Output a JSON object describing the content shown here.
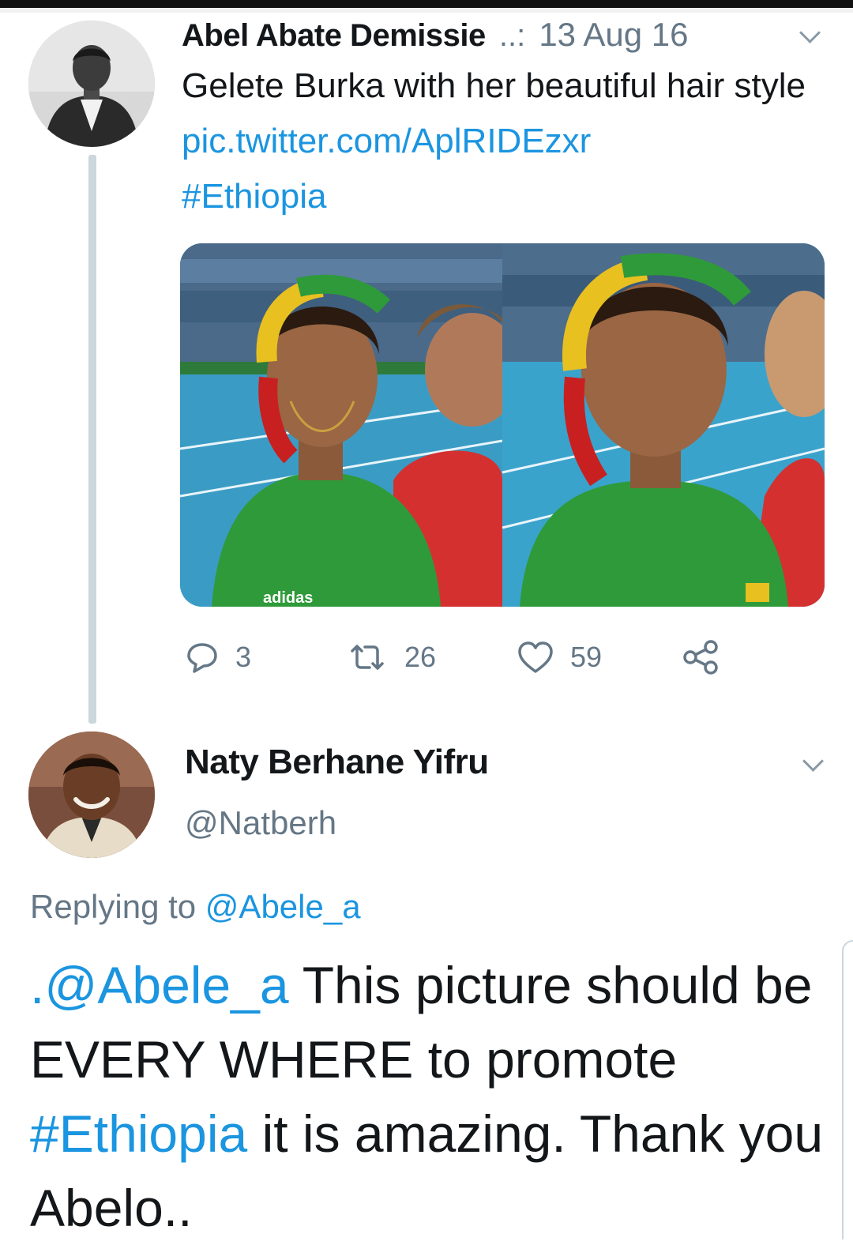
{
  "tweet1": {
    "author_name": "Abel Abate Demissie",
    "separator": "..:",
    "date": "13 Aug 16",
    "text_plain": "Gelete Burka with her beautiful hair style",
    "link": "pic.twitter.com/AplRIDEzxr",
    "hashtag": "#Ethiopia",
    "media_alt_brand": "adidas",
    "actions": {
      "replies": "3",
      "retweets": "26",
      "likes": "59"
    }
  },
  "tweet2": {
    "author_name": "Naty Berhane Yifru",
    "handle": "@Natberh",
    "replying_prefix": "Replying to",
    "replying_handle": "@Abele_a",
    "body_mention": ".@Abele_a",
    "body_part1": "This picture should be EVERY WHERE to promote",
    "body_hashtag": "#Ethiopia",
    "body_part2": "it is amazing. Thank you Abelo.."
  },
  "icons": [
    "reply-icon",
    "retweet-icon",
    "like-icon",
    "share-icon",
    "chevron-down-icon"
  ],
  "colors": {
    "link": "#1b95e0",
    "secondary_text": "#657786",
    "thread_line": "#ccd6dd",
    "jersey_green": "#2f9a3a"
  }
}
